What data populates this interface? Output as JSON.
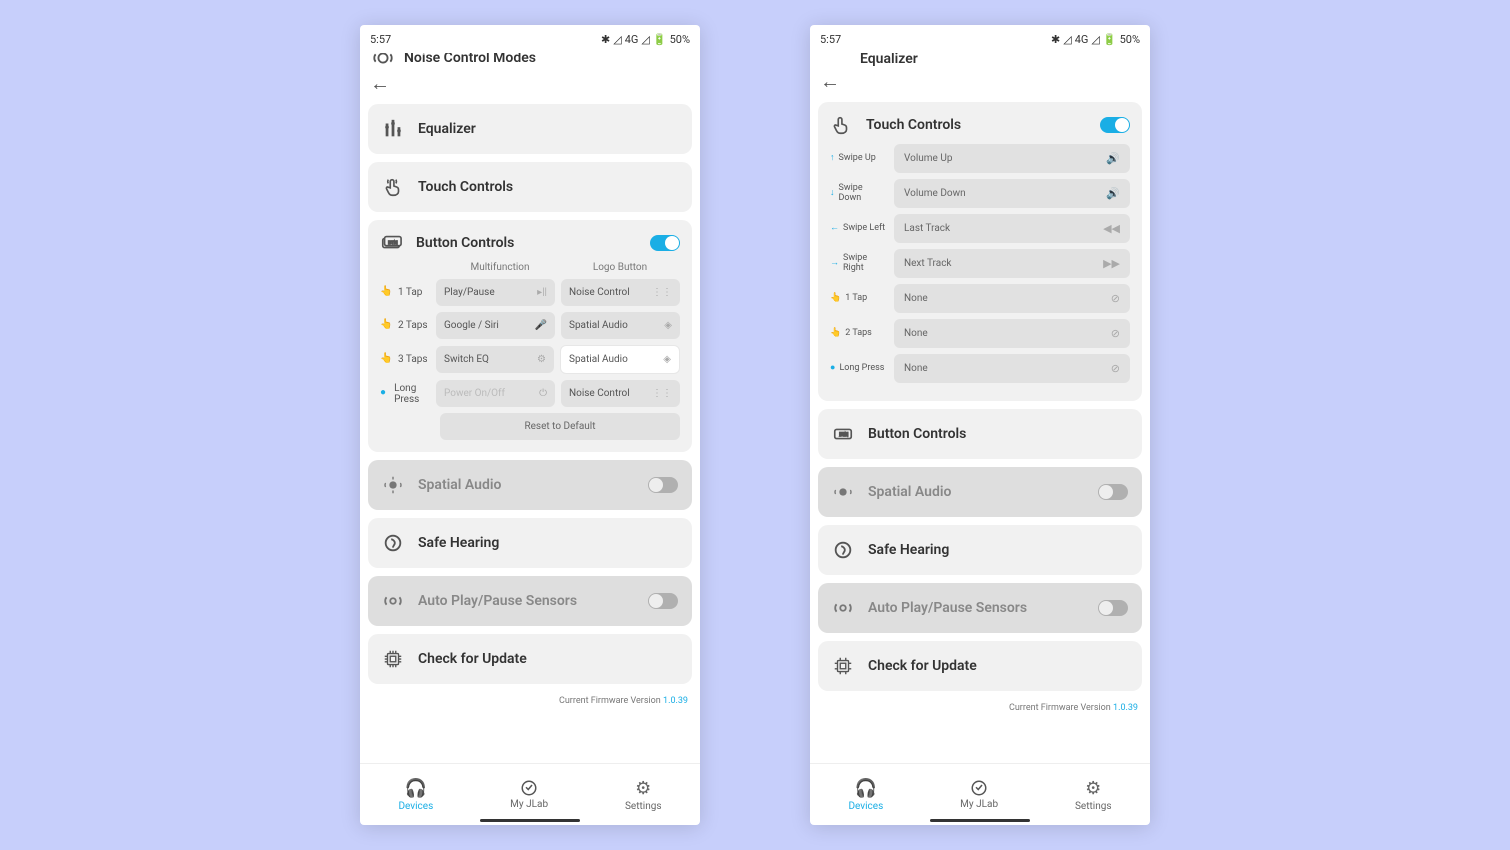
{
  "status": {
    "time": "5:57",
    "signal": "4G",
    "battery": "50%"
  },
  "left": {
    "headerTruncated": "Noise Control Modes",
    "equalizer": "Equalizer",
    "touchControls": "Touch Controls",
    "buttonControls": {
      "title": "Button Controls",
      "toggle": true,
      "colA": "Multifunction",
      "colB": "Logo Button",
      "rows": [
        {
          "label": "1 Tap",
          "a": "Play/Pause",
          "aicon": "play-pause",
          "b": "Noise Control",
          "bicon": "noise"
        },
        {
          "label": "2 Taps",
          "a": "Google / Siri",
          "aicon": "mic",
          "b": "Spatial Audio",
          "bicon": "spatial"
        },
        {
          "label": "3 Taps",
          "a": "Switch EQ",
          "aicon": "sliders",
          "b": "Spatial Audio",
          "bicon": "spatial",
          "blight": true
        },
        {
          "label": "Long Press",
          "a": "Power On/Off",
          "aicon": "power",
          "adisabled": true,
          "b": "Noise Control",
          "bicon": "noise"
        }
      ],
      "reset": "Reset to Default"
    },
    "spatialAudio": "Spatial Audio",
    "safeHearing": "Safe Hearing",
    "autoPlay": "Auto Play/Pause Sensors",
    "checkUpdate": "Check for Update",
    "firmwareLabel": "Current Firmware Version",
    "firmwareVersion": "1.0.39"
  },
  "right": {
    "equalizer": "Equalizer",
    "touchControls": {
      "title": "Touch Controls",
      "toggle": true,
      "rows": [
        {
          "label": "Swipe Up",
          "val": "Volume Up",
          "icon": "vol"
        },
        {
          "label": "Swipe Down",
          "val": "Volume Down",
          "icon": "vol"
        },
        {
          "label": "Swipe Left",
          "val": "Last Track",
          "icon": "prev"
        },
        {
          "label": "Swipe Right",
          "val": "Next Track",
          "icon": "next"
        },
        {
          "label": "1 Tap",
          "val": "None",
          "icon": "none"
        },
        {
          "label": "2 Taps",
          "val": "None",
          "icon": "none"
        },
        {
          "label": "Long Press",
          "val": "None",
          "icon": "none"
        }
      ]
    },
    "buttonControls": "Button Controls",
    "spatialAudio": "Spatial Audio",
    "safeHearing": "Safe Hearing",
    "autoPlay": "Auto Play/Pause Sensors",
    "checkUpdate": "Check for Update",
    "firmwareLabel": "Current Firmware Version",
    "firmwareVersion": "1.0.39"
  },
  "tabs": {
    "devices": "Devices",
    "myjlab": "My JLab",
    "settings": "Settings"
  }
}
